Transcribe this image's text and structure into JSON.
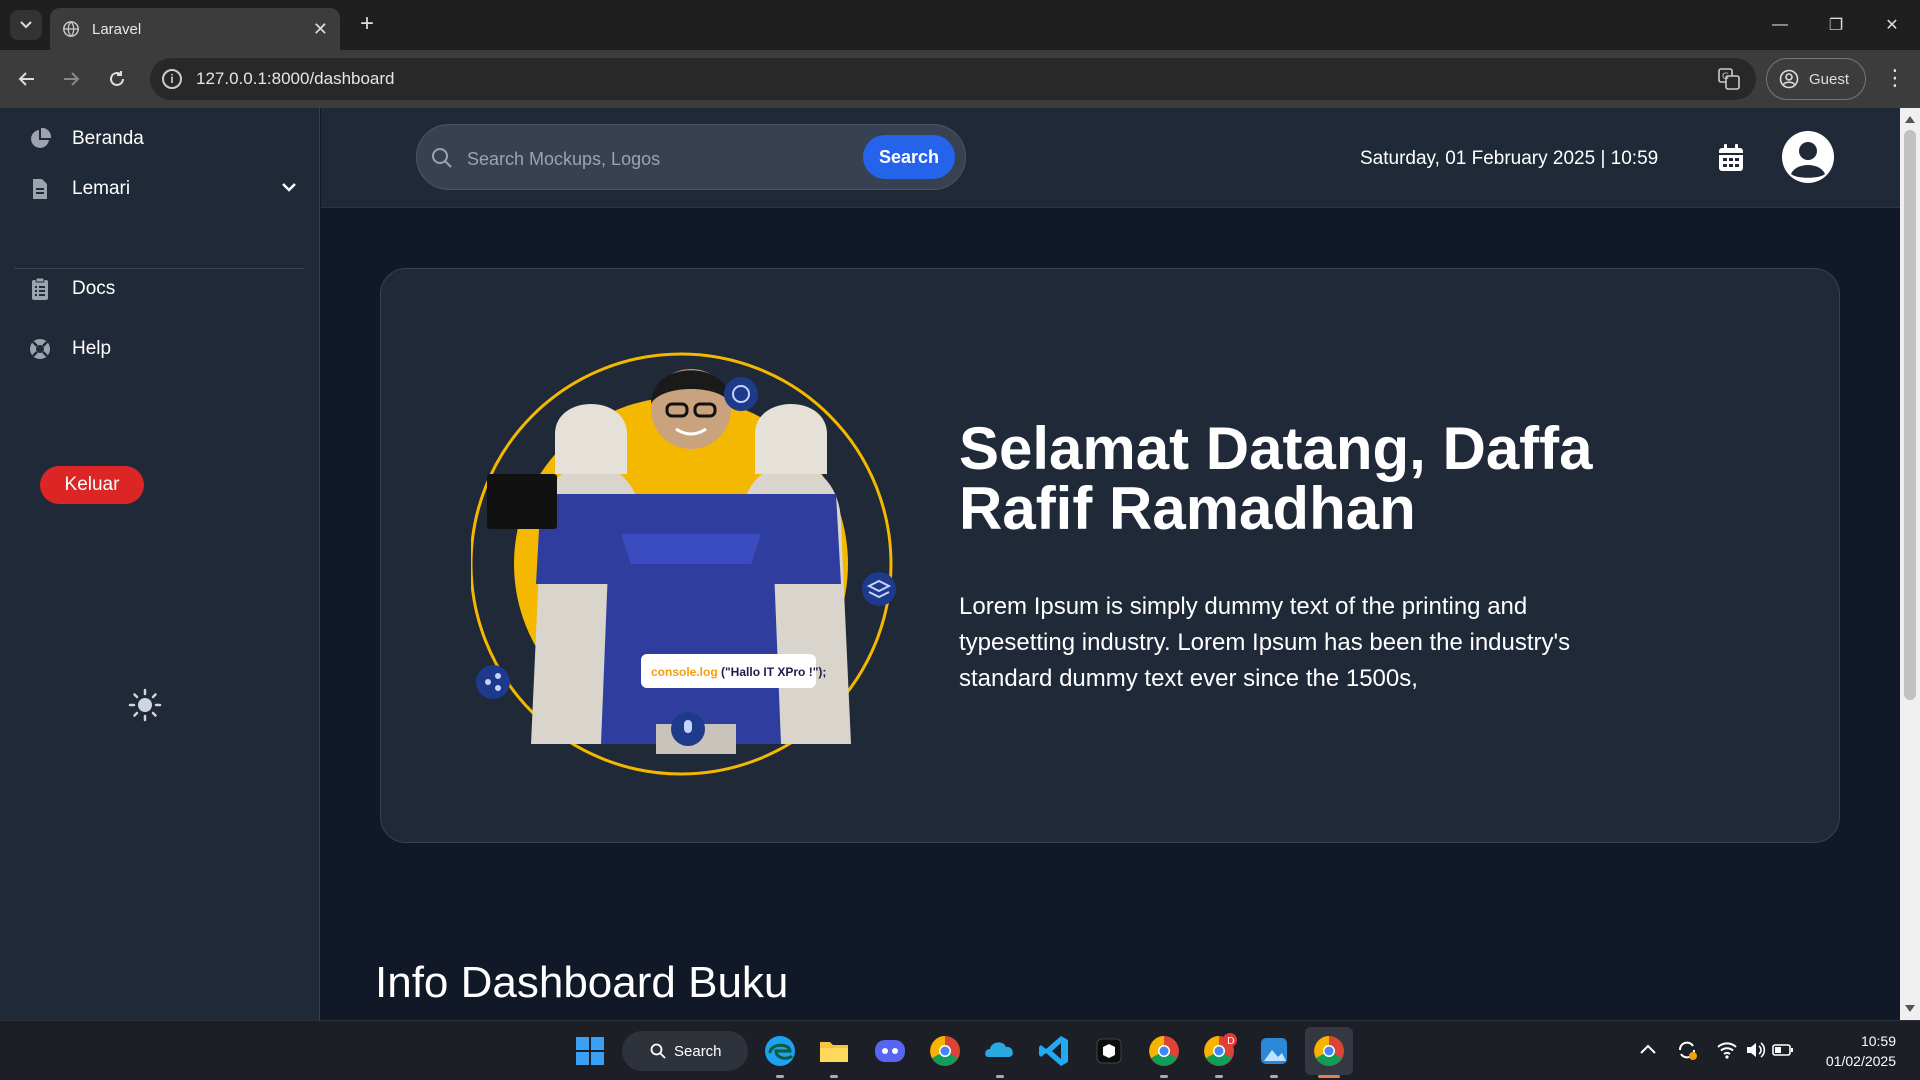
{
  "browser": {
    "tab_title": "Laravel",
    "url": "127.0.0.1:8000/dashboard",
    "profile_label": "Guest"
  },
  "sidebar": {
    "items": [
      {
        "label": "Beranda",
        "icon": "pie-chart-icon"
      },
      {
        "label": "Lemari",
        "icon": "document-icon"
      },
      {
        "label": "Docs",
        "icon": "clipboard-list-icon"
      },
      {
        "label": "Help",
        "icon": "life-ring-icon"
      }
    ],
    "logout_label": "Keluar"
  },
  "topbar": {
    "search_placeholder": "Search Mockups, Logos",
    "search_button": "Search",
    "datetime": "Saturday, 01 February 2025 | 10:59"
  },
  "hero": {
    "title": "Selamat Datang, Daffa Rafif Ramadhan",
    "text": "Lorem Ipsum is simply dummy text of the printing and typesetting industry. Lorem Ipsum has been the industry's standard dummy text ever since the 1500s,",
    "code_label_fn": "console.log",
    "code_label_arg": "(\"Hallo IT XPro !\");"
  },
  "section_title": "Info Dashboard Buku",
  "taskbar": {
    "search_label": "Search",
    "time": "10:59",
    "date": "01/02/2025",
    "badge": "D"
  },
  "colors": {
    "accent_blue": "#2563eb",
    "logout_red": "#dc2626",
    "hero_yellow": "#f5b800",
    "panel": "#1f2937",
    "background": "#111827"
  }
}
